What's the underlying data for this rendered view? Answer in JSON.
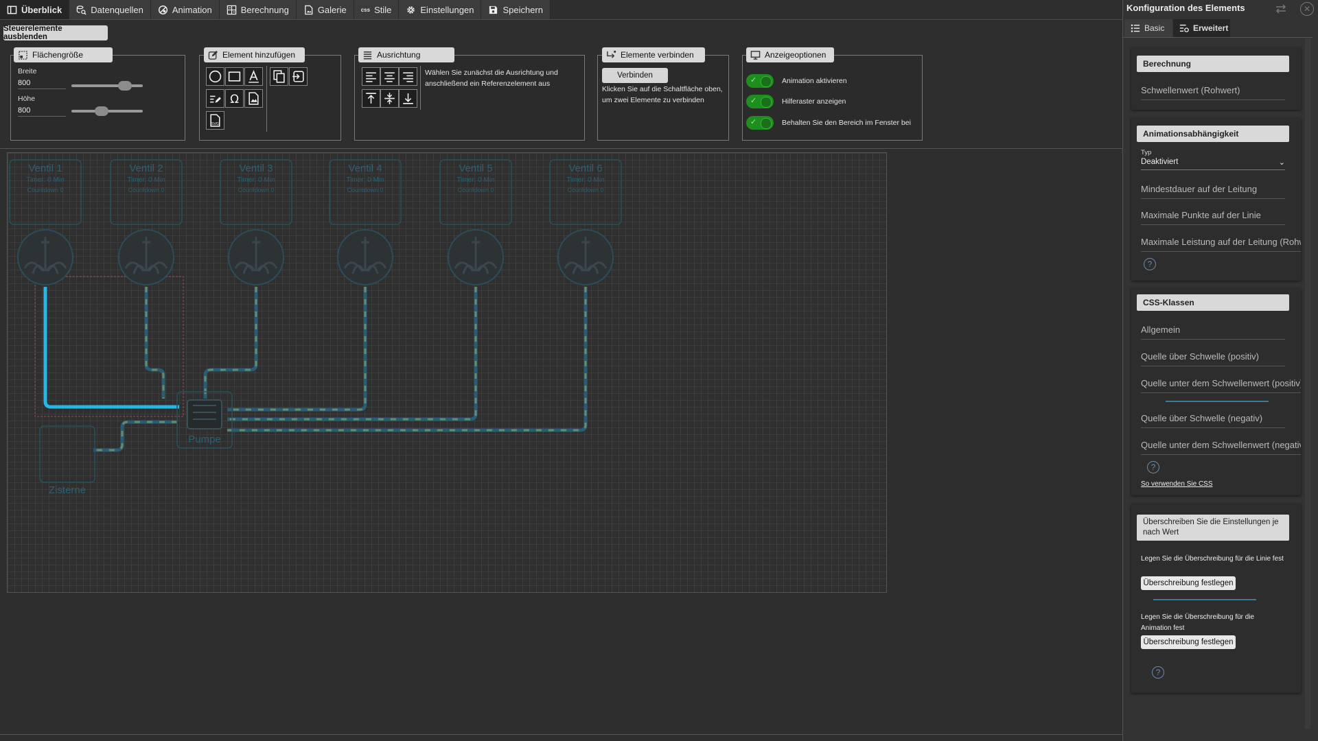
{
  "tabs": [
    {
      "label": "Überblick",
      "icon": "layout-icon",
      "active": true
    },
    {
      "label": "Datenquellen",
      "icon": "search-data-icon"
    },
    {
      "label": "Animation",
      "icon": "animation-icon"
    },
    {
      "label": "Berechnung",
      "icon": "calculator-icon"
    },
    {
      "label": "Galerie",
      "icon": "gallery-icon"
    },
    {
      "label": "Stile",
      "icon": "css-icon",
      "prefix": "css"
    },
    {
      "label": "Einstellungen",
      "icon": "gear-icon"
    },
    {
      "label": "Speichern",
      "icon": "save-icon"
    }
  ],
  "hide_controls_label": "Steuerelemente ausblenden",
  "size_panel": {
    "title": "Flächengröße",
    "width_label": "Breite",
    "width_value": "800",
    "height_label": "Höhe",
    "height_value": "800",
    "width_level": 0.75,
    "height_level": 0.42
  },
  "add_panel": {
    "title": "Element hinzufügen"
  },
  "align_panel": {
    "title": "Ausrichtung",
    "hint": "Wählen Sie zunächst die Ausrichtung und anschließend ein Referenzelement aus"
  },
  "connect_panel": {
    "title": "Elemente verbinden",
    "button": "Verbinden",
    "hint": "Klicken Sie auf die Schaltfläche oben, um zwei Elemente zu verbinden"
  },
  "display_panel": {
    "title": "Anzeigeoptionen",
    "options": [
      "Animation aktivieren",
      "Hilferaster anzeigen",
      "Behalten Sie den Bereich im Fenster bei"
    ]
  },
  "canvas": {
    "valves": [
      {
        "name": "Ventil 1",
        "timer": "Timer: 0 Min",
        "countdown": "Countdown 0"
      },
      {
        "name": "Ventil 2",
        "timer": "Timer: 0 Min",
        "countdown": "Countdown 0"
      },
      {
        "name": "Ventil 3",
        "timer": "Timer: 0 Min",
        "countdown": "Countdown 0"
      },
      {
        "name": "Ventil 4",
        "timer": "Timer: 0 Min",
        "countdown": "Countdown 0"
      },
      {
        "name": "Ventil 5",
        "timer": "Timer: 0 Min",
        "countdown": "Countdown 0"
      },
      {
        "name": "Ventil 6",
        "timer": "Timer: 0 Min",
        "countdown": "Countdown 0"
      }
    ],
    "pump_label": "Pumpe",
    "cistern_label": "Zisterne"
  },
  "sidebar": {
    "title": "Konfiguration des Elements",
    "tab_basic": "Basic",
    "tab_advanced": "Erweitert",
    "calc_head": "Berechnung",
    "calc_field": "Schwellenwert (Rohwert)",
    "anim_head": "Animationsabhängigkeit",
    "type_label": "Typ",
    "type_value": "Deaktiviert",
    "anim_fields": [
      "Mindestdauer auf der Leitung",
      "Maximale Punkte auf der Linie",
      "Maximale Leistung auf der Leitung (Rohw"
    ],
    "css_head": "CSS-Klassen",
    "css_fields": [
      "Allgemein",
      "Quelle über Schwelle (positiv)",
      "Quelle unter dem Schwellenwert (positiv)",
      "Quelle über Schwelle (negativ)",
      "Quelle unter dem Schwellenwert (negativ"
    ],
    "css_link": "So verwenden Sie CSS",
    "override_head": "Überschreiben Sie die Einstellungen je nach Wert",
    "override_line_text": "Legen Sie die Überschreibung für die Linie fest",
    "override_anim_text": "Legen Sie die Überschreibung für die Animation fest",
    "override_btn": "Überschreibung festlegen",
    "help": "?"
  },
  "colors": {
    "accent_line": "#29b6e6",
    "pipe": "#2a5d73",
    "toggle_on": "#1e8f1e"
  }
}
